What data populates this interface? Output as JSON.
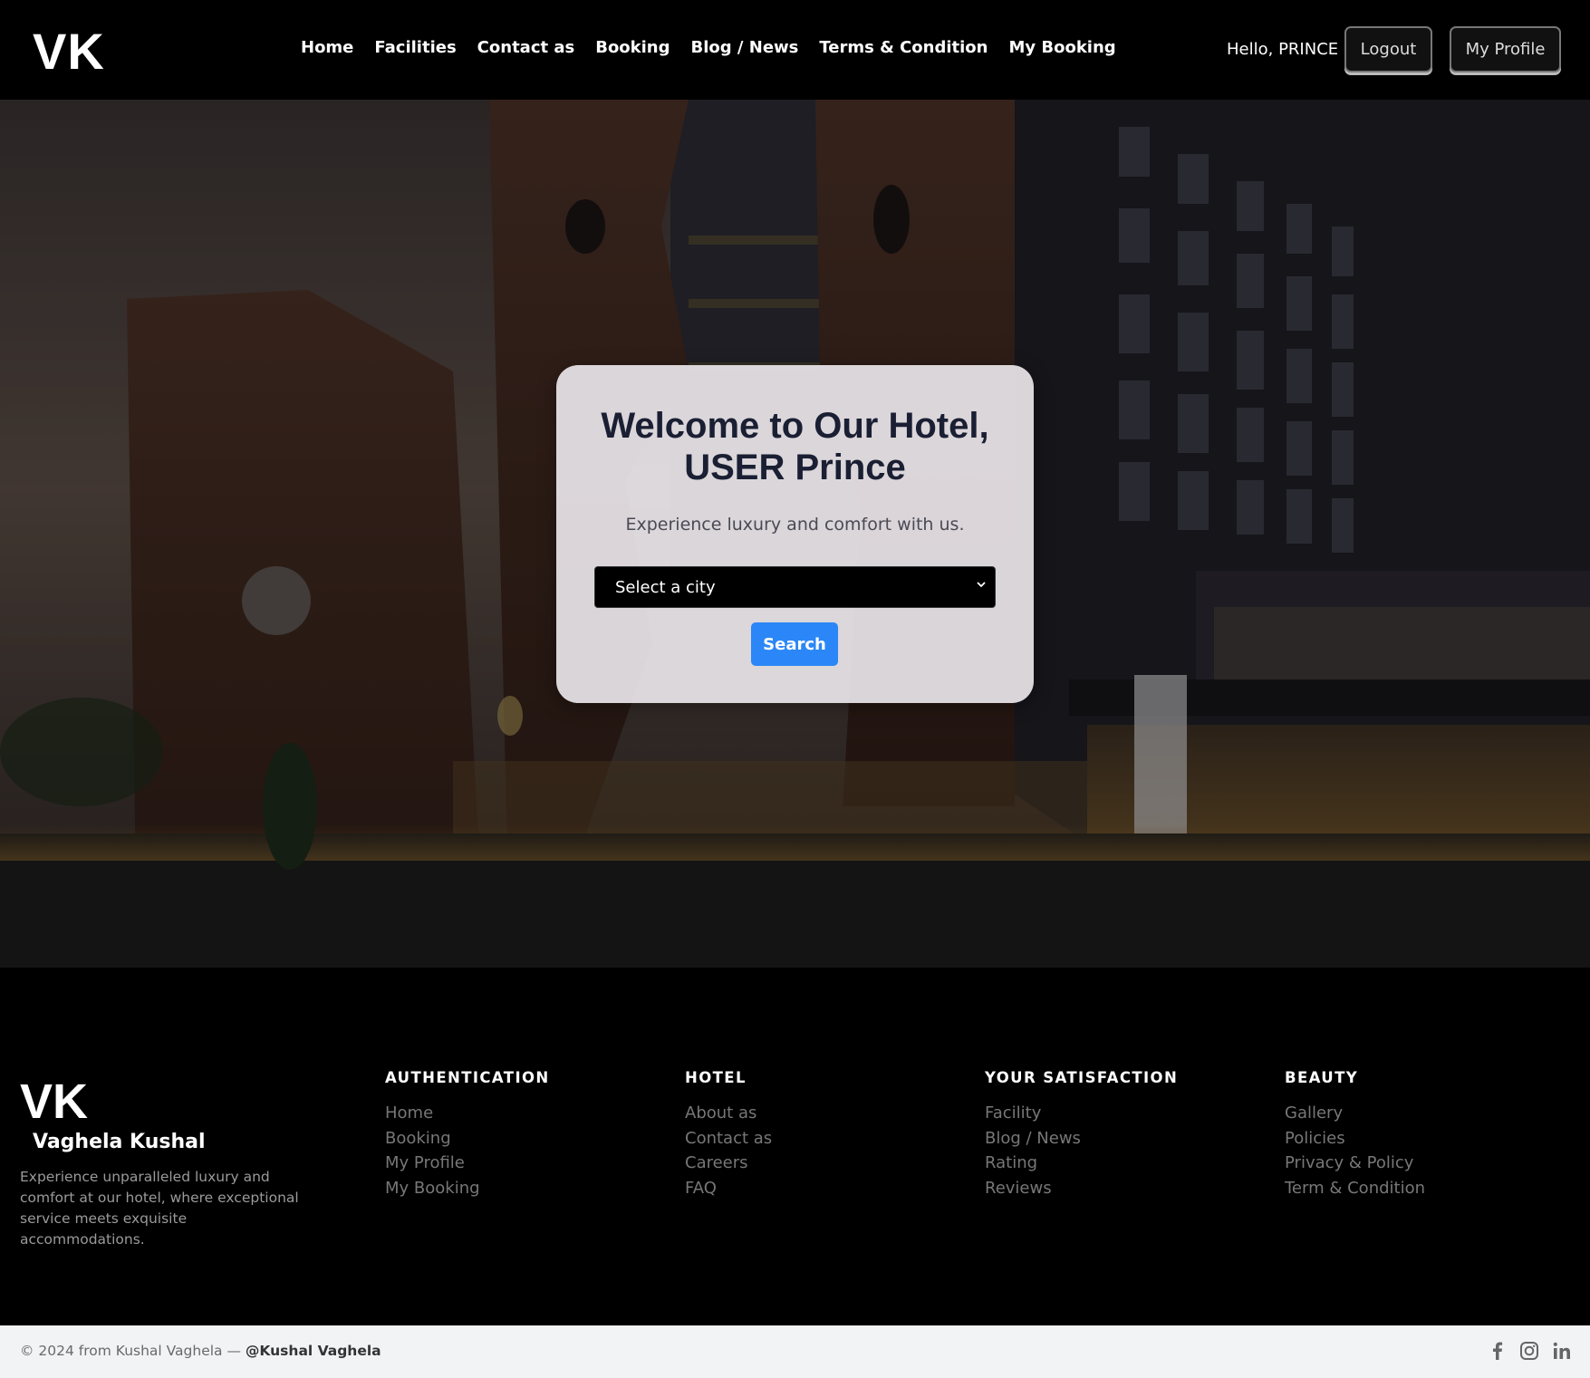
{
  "navbar": {
    "logo": "VK",
    "links": [
      "Home",
      "Facilities",
      "Contact as",
      "Booking",
      "Blog / News",
      "Terms & Condition",
      "My Booking"
    ],
    "greeting": "Hello, PRINCE",
    "logout_label": "Logout",
    "profile_label": "My Profile"
  },
  "hero": {
    "title_line1": "Welcome to Our Hotel,",
    "title_line2": "USER Prince",
    "subtitle": "Experience luxury and comfort with us.",
    "city_select": "Select a city",
    "search_label": "Search"
  },
  "footer": {
    "logo": "VK",
    "name": "Vaghela Kushal",
    "description": "Experience unparalleled luxury and comfort at our hotel, where exceptional service meets exquisite accommodations.",
    "columns": [
      {
        "heading": "AUTHENTICATION",
        "items": [
          "Home",
          "Booking",
          "My Profile",
          "My Booking"
        ]
      },
      {
        "heading": "HOTEL",
        "items": [
          "About as",
          "Contact as",
          "Careers",
          "FAQ"
        ]
      },
      {
        "heading": "YOUR SATISFACTION",
        "items": [
          "Facility",
          "Blog / News",
          "Rating",
          "Reviews"
        ]
      },
      {
        "heading": "BEAUTY",
        "items": [
          "Gallery",
          "Policies",
          "Privacy & Policy",
          "Term & Condition"
        ]
      }
    ]
  },
  "bottombar": {
    "copyright": "© 2024 from Kushal Vaghela — ",
    "handle": "@Kushal Vaghela",
    "social_icons": [
      "facebook-icon",
      "instagram-icon",
      "linkedin-icon"
    ]
  }
}
